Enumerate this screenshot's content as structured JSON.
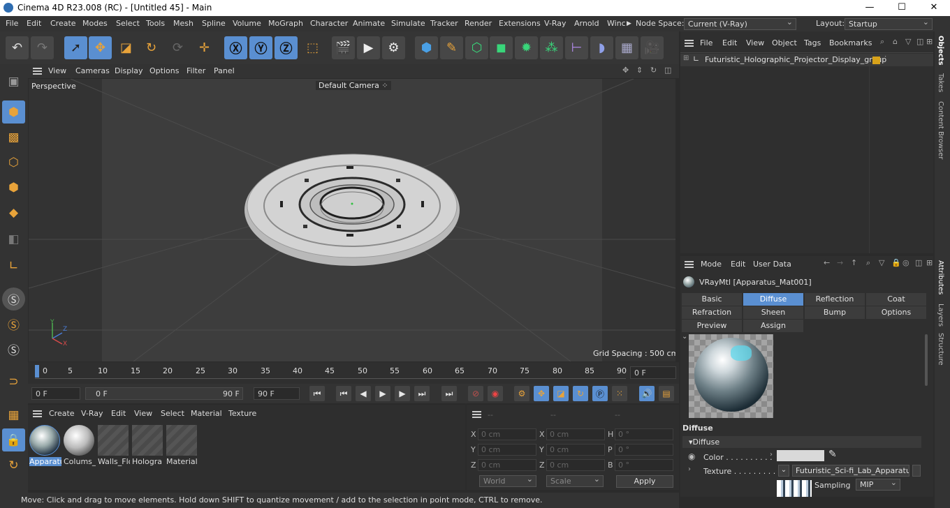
{
  "window": {
    "title": "Cinema 4D R23.008 (RC) - [Untitled 45] - Main",
    "minimize": "—",
    "maximize": "☐",
    "close": "✕"
  },
  "menu": [
    "File",
    "Edit",
    "Create",
    "Modes",
    "Select",
    "Tools",
    "Mesh",
    "Spline",
    "Volume",
    "MoGraph",
    "Character",
    "Animate",
    "Simulate",
    "Tracker",
    "Render",
    "Extensions",
    "V-Ray",
    "Arnold",
    "Winc"
  ],
  "node_space": {
    "label": "Node Space:",
    "value": "Current (V-Ray)"
  },
  "layout": {
    "label": "Layout:",
    "value": "Startup"
  },
  "viewport": {
    "menu": [
      "View",
      "Cameras",
      "Display",
      "Options",
      "Filter",
      "Panel"
    ],
    "view_name": "Perspective",
    "camera": "Default Camera",
    "grid_spacing": "Grid Spacing : 500 cm",
    "axis_labels": {
      "y": "Y",
      "z": "Z",
      "x": "X"
    }
  },
  "timeline": {
    "ticks": [
      "0",
      "5",
      "10",
      "15",
      "20",
      "25",
      "30",
      "35",
      "40",
      "45",
      "50",
      "55",
      "60",
      "65",
      "70",
      "75",
      "80",
      "85",
      "90"
    ],
    "current": "0 F"
  },
  "transport": {
    "start": "0 F",
    "range_start": "0 F",
    "range_end": "90 F",
    "end": "90 F"
  },
  "materials": {
    "menu": [
      "Create",
      "V-Ray",
      "Edit",
      "View",
      "Select",
      "Material",
      "Texture"
    ],
    "items": [
      "Apparatu",
      "Colums_",
      "Walls_Flo",
      "Hologra",
      "Material"
    ]
  },
  "coordinates": {
    "headers": [
      "--",
      "--",
      "--"
    ],
    "rows": [
      {
        "a": "X",
        "av": "0 cm",
        "b": "X",
        "bv": "0 cm",
        "c": "H",
        "cv": "0 °"
      },
      {
        "a": "Y",
        "av": "0 cm",
        "b": "Y",
        "bv": "0 cm",
        "c": "P",
        "cv": "0 °"
      },
      {
        "a": "Z",
        "av": "0 cm",
        "b": "Z",
        "bv": "0 cm",
        "c": "B",
        "cv": "0 °"
      }
    ],
    "world": "World",
    "scale": "Scale",
    "apply": "Apply"
  },
  "status": "Move: Click and drag to move elements. Hold down SHIFT to quantize movement / add to the selection in point mode, CTRL to remove.",
  "objects": {
    "menu": [
      "File",
      "Edit",
      "View",
      "Object",
      "Tags",
      "Bookmarks"
    ],
    "tree": [
      {
        "name": "Futuristic_Holographic_Projector_Display_group"
      }
    ]
  },
  "attributes": {
    "menu": [
      "Mode",
      "Edit",
      "User Data"
    ],
    "material_title": "VRayMtl [Apparatus_Mat001]",
    "tabs_row1": [
      "Basic",
      "Diffuse",
      "Reflection",
      "Coat"
    ],
    "tabs_row2": [
      "Refraction",
      "Sheen",
      "Bump",
      "Options"
    ],
    "tabs_row3": [
      "Preview Settings",
      "Assign"
    ],
    "section": "Diffuse",
    "group": "Diffuse",
    "color_label": "Color . . . . . . . . . .",
    "texture_label": "Texture . . . . . . . . .",
    "texture_value": "Futuristic_Sci-fi_Lab_Apparatus_B",
    "sampling_label": "Sampling",
    "sampling_value": "MIP"
  },
  "side_tabs": [
    "Objects",
    "Takes",
    "Content Browser",
    "Attributes",
    "Layers",
    "Structure"
  ],
  "colors": {
    "accent": "#5a8fd1",
    "tool_orange": "#e8a33a",
    "bg": "#2b2b2b"
  }
}
